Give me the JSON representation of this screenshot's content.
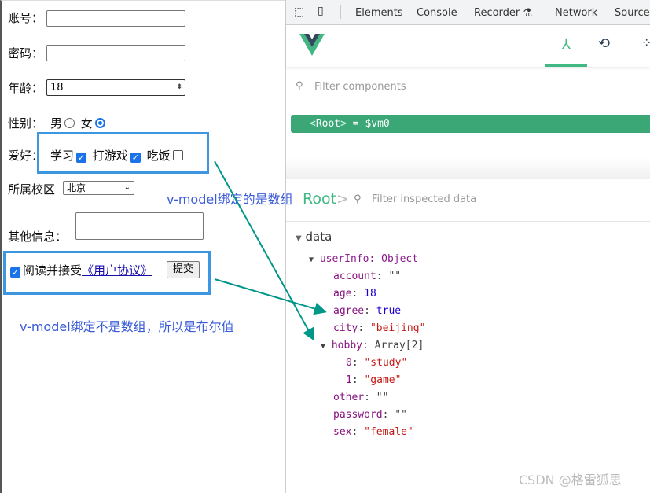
{
  "form": {
    "account_label": "账号：",
    "account_value": "",
    "password_label": "密码：",
    "password_value": "",
    "age_label": "年龄：",
    "age_value": "18",
    "sex_label": "性别：",
    "sex_male": "男",
    "sex_female": "女",
    "sex_selected": "female",
    "hobby_label": "爱好：",
    "hobbies": [
      {
        "label": "学习",
        "checked": true
      },
      {
        "label": "打游戏",
        "checked": true
      },
      {
        "label": "吃饭",
        "checked": false
      }
    ],
    "city_label": "所属校区",
    "city_value": "北京",
    "other_label": "其他信息：",
    "other_value": "",
    "agree_text": "阅读并接受",
    "agree_link": "《用户协议》",
    "agree_checked": true,
    "submit_label": "提交"
  },
  "annotations": {
    "array_note": "v-model绑定的是数组",
    "bool_note": "v-model绑定不是数组，所以是布尔值",
    "box_color": "#3c97e0",
    "arrow_color": "#009688",
    "note_color": "#3a5bd9"
  },
  "devtools": {
    "tabs": [
      "Elements",
      "Console",
      "Recorder",
      "Network",
      "Sources"
    ],
    "filter_components_placeholder": "Filter components",
    "root_row": {
      "tag": "Root",
      "suffix": "= $vm0"
    },
    "inspector_title": "Root",
    "filter_data_placeholder": "Filter inspected data",
    "section": "data",
    "tree": {
      "userInfo": "userInfo: Object",
      "fields": [
        {
          "key": "account",
          "value": "\"\"",
          "type": "str-empty"
        },
        {
          "key": "age",
          "value": "18",
          "type": "num"
        },
        {
          "key": "agree",
          "value": "true",
          "type": "num"
        },
        {
          "key": "city",
          "value": "\"beijing\"",
          "type": "str"
        },
        {
          "key": "hobby",
          "value": "Array[2]",
          "type": "obj"
        },
        {
          "key": "0",
          "value": "\"study\"",
          "type": "str"
        },
        {
          "key": "1",
          "value": "\"game\"",
          "type": "str"
        },
        {
          "key": "other",
          "value": "\"\"",
          "type": "str-empty"
        },
        {
          "key": "password",
          "value": "\"\"",
          "type": "str-empty"
        },
        {
          "key": "sex",
          "value": "\"female\"",
          "type": "str"
        }
      ]
    },
    "accent": "#41b883"
  },
  "watermark": "CSDN @格雷狐思"
}
